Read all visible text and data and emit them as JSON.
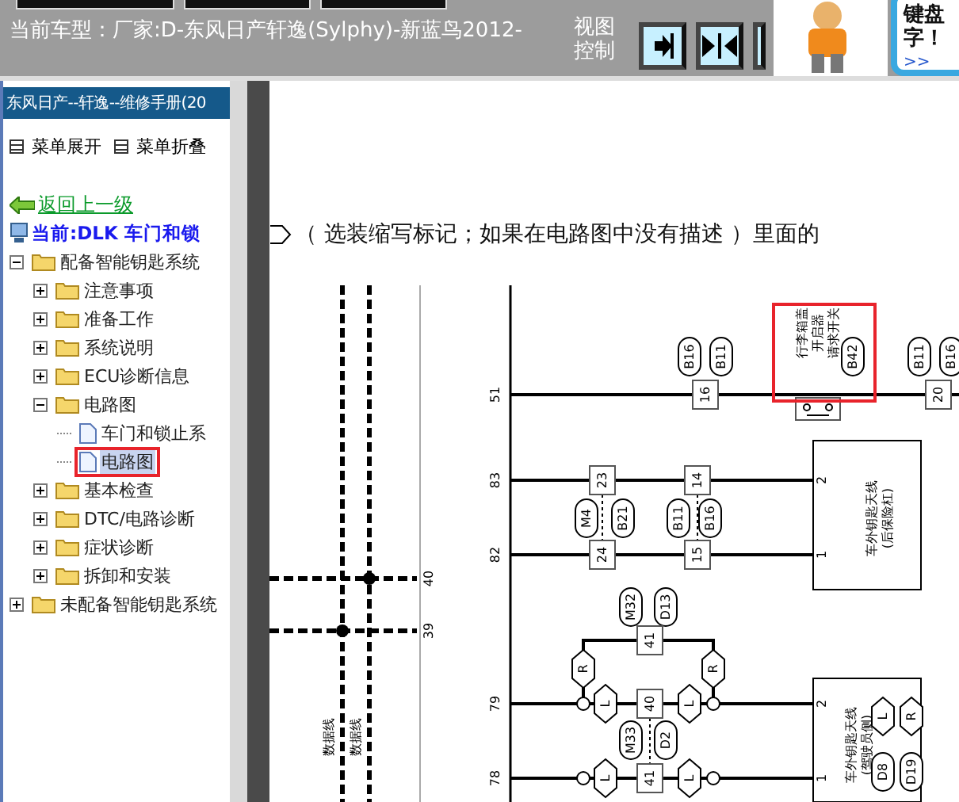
{
  "top_bar": {
    "vehicle": "当前车型：厂家:D-东风日产轩逸(Sylphy)-新蓝鸟2012-",
    "view_control": "视图控制",
    "bubble_lines": [
      "键盘",
      "字！"
    ],
    "bubble_link": ">>"
  },
  "sidebar": {
    "title": "东风日产--轩逸--维修手册(20",
    "menu": [
      {
        "label": "菜单展开"
      },
      {
        "label": "菜单折叠"
      }
    ],
    "back_link": "返回上一级",
    "current": "当前:DLK 车门和锁",
    "tree": [
      {
        "label": "配备智能钥匙系统",
        "kind": "folder",
        "expanded": true,
        "selected": false,
        "children": [
          {
            "label": "注意事项",
            "kind": "folder",
            "expanded": false,
            "selected": false
          },
          {
            "label": "准备工作",
            "kind": "folder",
            "expanded": false,
            "selected": false
          },
          {
            "label": "系统说明",
            "kind": "folder",
            "expanded": false,
            "selected": false
          },
          {
            "label": "ECU诊断信息",
            "kind": "folder",
            "expanded": false,
            "selected": false
          },
          {
            "label": "电路图",
            "kind": "folder",
            "expanded": true,
            "selected": false,
            "children": [
              {
                "label": "车门和锁止系",
                "kind": "page",
                "selected": false,
                "highlighted": false
              },
              {
                "label": "电路图",
                "kind": "page",
                "selected": true,
                "highlighted": true
              }
            ]
          },
          {
            "label": "基本检查",
            "kind": "folder",
            "expanded": false,
            "selected": false
          },
          {
            "label": "DTC/电路诊断",
            "kind": "folder",
            "expanded": false,
            "selected": false
          },
          {
            "label": "症状诊断",
            "kind": "folder",
            "expanded": false,
            "selected": false
          },
          {
            "label": "拆卸和安装",
            "kind": "folder",
            "expanded": false,
            "selected": false
          }
        ]
      },
      {
        "label": "未配备智能钥匙系统",
        "kind": "folder",
        "expanded": false,
        "selected": false
      }
    ]
  },
  "diagram": {
    "caption": "（ 选装缩写标记；如果在电路图中没有描述 ）里面的",
    "row_numbers": [
      "51",
      "83",
      "82",
      "40",
      "39",
      "79",
      "78"
    ],
    "wire_labels": [
      "数据线",
      "数据线"
    ],
    "connectors": [
      {
        "kind": "oval",
        "label": "B16"
      },
      {
        "kind": "oval",
        "label": "B11"
      },
      {
        "kind": "box",
        "label": "16"
      },
      {
        "kind": "oval",
        "label": "B42"
      },
      {
        "kind": "oval",
        "label": "B11"
      },
      {
        "kind": "oval",
        "label": "B16"
      },
      {
        "kind": "box",
        "label": "20"
      },
      {
        "kind": "box",
        "label": "23"
      },
      {
        "kind": "oval",
        "label": "M4"
      },
      {
        "kind": "oval",
        "label": "B21"
      },
      {
        "kind": "box",
        "label": "24"
      },
      {
        "kind": "box",
        "label": "14"
      },
      {
        "kind": "oval",
        "label": "B11"
      },
      {
        "kind": "oval",
        "label": "B16"
      },
      {
        "kind": "box",
        "label": "15"
      },
      {
        "kind": "oval",
        "label": "M32"
      },
      {
        "kind": "oval",
        "label": "D13"
      },
      {
        "kind": "box",
        "label": "41"
      },
      {
        "kind": "hex",
        "label": "R"
      },
      {
        "kind": "hex",
        "label": "R"
      },
      {
        "kind": "hex",
        "label": "L"
      },
      {
        "kind": "box",
        "label": "40"
      },
      {
        "kind": "hex",
        "label": "L"
      },
      {
        "kind": "oval",
        "label": "M33"
      },
      {
        "kind": "oval",
        "label": "D2"
      },
      {
        "kind": "hex",
        "label": "L"
      },
      {
        "kind": "box",
        "label": "41"
      },
      {
        "kind": "hex",
        "label": "L"
      },
      {
        "kind": "hex",
        "label": "L"
      },
      {
        "kind": "hex",
        "label": "R"
      },
      {
        "kind": "oval",
        "label": "D8"
      },
      {
        "kind": "oval",
        "label": "D19"
      }
    ],
    "components": [
      {
        "lines": [
          "行李箱盖",
          "开启器",
          "请求开关"
        ],
        "highlighted": true
      },
      {
        "lines": [
          "车外钥匙天线",
          "(后保险杠)"
        ],
        "highlighted": false
      },
      {
        "lines": [
          "车外钥匙天线",
          "(驾驶员侧)"
        ],
        "highlighted": false
      }
    ],
    "pins": [
      "2",
      "1",
      "2",
      "1"
    ]
  }
}
